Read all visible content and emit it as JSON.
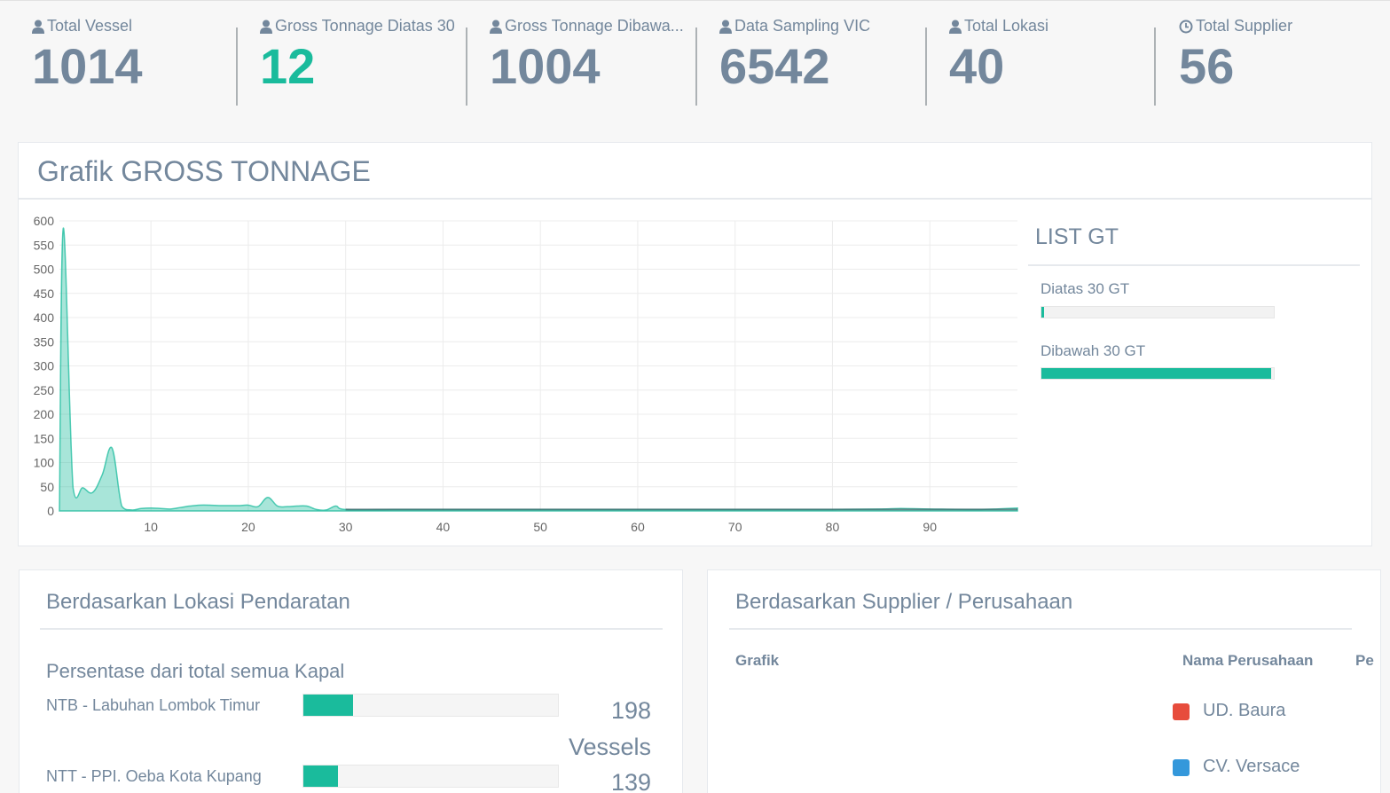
{
  "stats": [
    {
      "label": "Total Vessel",
      "value": "1014",
      "icon": "user-icon",
      "highlight": false
    },
    {
      "label": "Gross Tonnage Diatas 30",
      "value": "12",
      "icon": "user-icon",
      "highlight": true
    },
    {
      "label": "Gross Tonnage Dibawa...",
      "value": "1004",
      "icon": "user-icon",
      "highlight": false
    },
    {
      "label": "Data Sampling VIC",
      "value": "6542",
      "icon": "user-icon",
      "highlight": false
    },
    {
      "label": "Total Lokasi",
      "value": "40",
      "icon": "user-icon",
      "highlight": false
    },
    {
      "label": "Total Supplier",
      "value": "56",
      "icon": "clock-icon",
      "highlight": false
    }
  ],
  "gt_panel": {
    "title": "Grafik GROSS TONNAGE",
    "list_title": "LIST GT",
    "items": [
      {
        "label": "Diatas 30 GT",
        "fraction": 0.012
      },
      {
        "label": "Dibawah 30 GT",
        "fraction": 0.99
      }
    ]
  },
  "chart_data": {
    "type": "area",
    "title": "",
    "xlabel": "",
    "ylabel": "",
    "xlim": [
      0.6,
      99
    ],
    "ylim": [
      0,
      600
    ],
    "x_ticks": [
      10,
      20,
      30,
      40,
      50,
      60,
      70,
      80,
      90
    ],
    "y_ticks": [
      0,
      50,
      100,
      150,
      200,
      250,
      300,
      350,
      400,
      450,
      500,
      550,
      600
    ],
    "grid": true,
    "color": "#1abb9c",
    "x": [
      0.6,
      1,
      2,
      3,
      4,
      5,
      6,
      7,
      8,
      9,
      10,
      11,
      12,
      13,
      14,
      15,
      16,
      17,
      18,
      19,
      20,
      21,
      22,
      23,
      24,
      25,
      26,
      27,
      28,
      29,
      30,
      35,
      40,
      45,
      50,
      55,
      60,
      65,
      70,
      75,
      80,
      85,
      87,
      90,
      95,
      99
    ],
    "values": [
      0,
      585,
      48,
      48,
      38,
      75,
      130,
      10,
      2,
      5,
      6,
      5,
      4,
      7,
      10,
      12,
      12,
      11,
      11,
      11,
      12,
      9,
      28,
      10,
      9,
      10,
      10,
      3,
      2,
      10,
      3,
      3,
      3,
      3,
      3,
      3,
      3,
      3,
      3,
      3,
      3,
      4,
      5,
      4,
      3,
      6
    ]
  },
  "location_panel": {
    "title": "Berdasarkan Lokasi Pendaratan",
    "subtitle": "Persentase dari total semua Kapal",
    "rows": [
      {
        "name": "NTB - Labuhan Lombok Timur",
        "count": "198",
        "unit": "Vessels",
        "fraction": 0.195
      },
      {
        "name": "NTT - PPI. Oeba Kota Kupang",
        "count": "139",
        "unit": "",
        "fraction": 0.137
      }
    ]
  },
  "supplier_panel": {
    "title": "Berdasarkan Supplier / Perusahaan",
    "col_chart": "Grafik",
    "col_name": "Nama Perusahaan",
    "col_third": "Pe",
    "rows": [
      {
        "name": "UD. Baura",
        "color": "#e74c3c"
      },
      {
        "name": "CV. Versace",
        "color": "#3498db"
      }
    ]
  }
}
